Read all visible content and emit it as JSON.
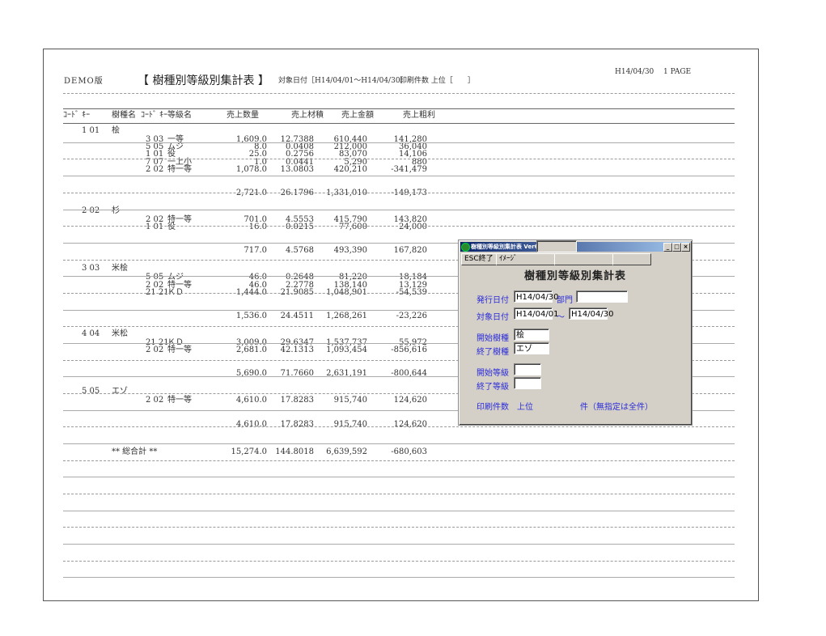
{
  "header": {
    "demo": "DEMO版",
    "title": "【 樹種別等級別集計表 】",
    "period": "対象日付［H14/04/01〜H14/04/30］",
    "print_top": "印刷件数 上位［　　］",
    "date": "H14/04/30",
    "page": "1 PAGE"
  },
  "columns": [
    "ｺｰﾄﾞ ｷｰ",
    "樹種名",
    "ｺｰﾄﾞ ｷｰ",
    "等級名",
    "売上数量",
    "売上材積",
    "売上金額",
    "売上粗利"
  ],
  "groups": [
    {
      "code": "1 01",
      "name": "桧",
      "rows": [
        {
          "code": "3 03",
          "grade": "一等",
          "qty": "1,609.0",
          "vol": "12.7388",
          "amt": "610,440",
          "profit": "141,280"
        },
        {
          "code": "5 05",
          "grade": "ムジ",
          "qty": "8.0",
          "vol": "0.0408",
          "amt": "212,000",
          "profit": "36,040"
        },
        {
          "code": "1 01",
          "grade": "役",
          "qty": "25.0",
          "vol": "0.2756",
          "amt": "83,070",
          "profit": "14,106"
        },
        {
          "code": "7 07",
          "grade": "一上小",
          "qty": "1.0",
          "vol": "0.0441",
          "amt": "5,290",
          "profit": "880"
        },
        {
          "code": "2 02",
          "grade": "特一等",
          "qty": "1,078.0",
          "vol": "13.0803",
          "amt": "420,210",
          "profit": "-341,479"
        }
      ],
      "total": {
        "qty": "2,721.0",
        "vol": "26.1796",
        "amt": "1,331,010",
        "profit": "-149,173"
      }
    },
    {
      "code": "2 02",
      "name": "杉",
      "rows": [
        {
          "code": "2 02",
          "grade": "特一等",
          "qty": "701.0",
          "vol": "4.5553",
          "amt": "415,790",
          "profit": "143,820"
        },
        {
          "code": "1 01",
          "grade": "役",
          "qty": "16.0",
          "vol": "0.0215",
          "amt": "77,600",
          "profit": "24,000"
        }
      ],
      "total": {
        "qty": "717.0",
        "vol": "4.5768",
        "amt": "493,390",
        "profit": "167,820"
      }
    },
    {
      "code": "3 03",
      "name": "米桧",
      "rows": [
        {
          "code": "5 05",
          "grade": "ムジ",
          "qty": "46.0",
          "vol": "0.2648",
          "amt": "81,220",
          "profit": "18,184"
        },
        {
          "code": "2 02",
          "grade": "特一等",
          "qty": "46.0",
          "vol": "2.2778",
          "amt": "138,140",
          "profit": "13,129"
        },
        {
          "code": "21 21",
          "grade": "ＫＤ",
          "qty": "1,444.0",
          "vol": "21.9085",
          "amt": "1,048,901",
          "profit": "-54,539"
        }
      ],
      "total": {
        "qty": "1,536.0",
        "vol": "24.4511",
        "amt": "1,268,261",
        "profit": "-23,226"
      }
    },
    {
      "code": "4 04",
      "name": "米松",
      "rows": [
        {
          "code": "21 21",
          "grade": "ＫＤ",
          "qty": "3,009.0",
          "vol": "29.6347",
          "amt": "1,537,737",
          "profit": "55,972"
        },
        {
          "code": "2 02",
          "grade": "特一等",
          "qty": "2,681.0",
          "vol": "42.1313",
          "amt": "1,093,454",
          "profit": "-856,616"
        }
      ],
      "total": {
        "qty": "5,690.0",
        "vol": "71.7660",
        "amt": "2,631,191",
        "profit": "-800,644"
      }
    },
    {
      "code": "5 05",
      "name": "エゾ",
      "rows": [
        {
          "code": "2 02",
          "grade": "特一等",
          "qty": "4,610.0",
          "vol": "17.8283",
          "amt": "915,740",
          "profit": "124,620"
        }
      ],
      "total": {
        "qty": "4,610.0",
        "vol": "17.8283",
        "amt": "915,740",
        "profit": "124,620"
      }
    }
  ],
  "grand_total": {
    "label": "** 総合計 **",
    "qty": "15,274.0",
    "vol": "144.8018",
    "amt": "6,639,592",
    "profit": "-680,603"
  },
  "dialog": {
    "window_title": "樹種別等級別集計表 Ver6.0",
    "esc_button": "ESC終了",
    "image_button": "ｲﾒｰｼﾞ",
    "heading": "樹種別等級別集計表",
    "issue_date_label": "発行日付",
    "issue_date": "H14/04/30",
    "dept_label": "部門",
    "dept": "",
    "target_date_label": "対象日付",
    "target_from": "H14/04/01",
    "tilde": "〜",
    "target_to": "H14/04/30",
    "start_species_label": "開始樹種",
    "start_species": "桧",
    "end_species_label": "終了樹種",
    "end_species": "エゾ",
    "start_grade_label": "開始等級",
    "start_grade": "",
    "end_grade_label": "終了等級",
    "end_grade": "",
    "print_count_label": "印刷件数　上位",
    "print_count": "",
    "print_count_note": "件（無指定は全件）"
  },
  "colors": {
    "label_blue": "#2b2bd8",
    "title_bar": "#0a246a",
    "dialog_bg": "#d4d0c8"
  }
}
